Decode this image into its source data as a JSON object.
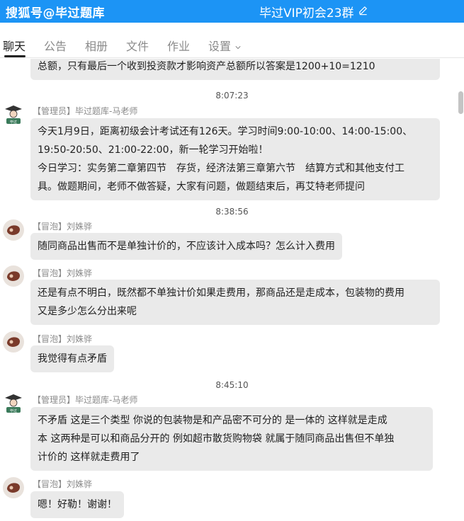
{
  "header": {
    "watermark": "搜狐号@毕过题库",
    "title": "毕过VIP初会23群",
    "edit_icon": "pencil-icon",
    "bg_color": "#1c94f5"
  },
  "tabs": [
    {
      "label": "聊天",
      "active": true
    },
    {
      "label": "公告"
    },
    {
      "label": "相册"
    },
    {
      "label": "文件"
    },
    {
      "label": "作业"
    },
    {
      "label": "设置",
      "icon": "chevron-down-icon"
    }
  ],
  "messages": {
    "m0": {
      "text": "总额，只有最后一个收到投资款才影响资产总额所以答案是1200+10=1210"
    },
    "t1": "8:07:23",
    "m1": {
      "sender": "【管理员】毕过题库-马老师",
      "lines": [
        "今天1月9日，距离初级会计考试还有126天。学习时间9:00-10:00、14:00-15:00、",
        "19:50-20:50、21:00-22:00，新一轮学习开始啦！",
        "今日学习：实务第二章第四节　存货，经济法第三章第六节　结算方式和其他支付工",
        "具。做题期间，老师不做答疑，大家有问题，做题结束后，再艾特老师提问"
      ]
    },
    "t2": "8:38:56",
    "m2": {
      "sender": "【冒泡】刘姝骅",
      "lines": [
        "随同商品出售而不是单独计价的，不应该计入成本吗？怎么计入费用"
      ]
    },
    "m3": {
      "sender": "【冒泡】刘姝骅",
      "lines": [
        "还是有点不明白，既然都不单独计价如果走费用，那商品还是走成本，包装物的费用",
        "又是多少怎么分出来呢"
      ]
    },
    "m4": {
      "sender": "【冒泡】刘姝骅",
      "lines": [
        "我觉得有点矛盾"
      ]
    },
    "t3": "8:45:10",
    "m5": {
      "sender": "【管理员】毕过题库-马老师",
      "lines": [
        "不矛盾  这是三个类型   你说的包装物是和产品密不可分的 是一体的  这样就是走成",
        "本  这两种是可以和商品分开的  例如超市散货购物袋 就属于随同商品出售但不单独",
        "计价的  这样就走费用了"
      ]
    },
    "m6": {
      "sender": "【冒泡】刘姝骅",
      "lines": [
        "嗯！好勒！谢谢！"
      ]
    }
  }
}
